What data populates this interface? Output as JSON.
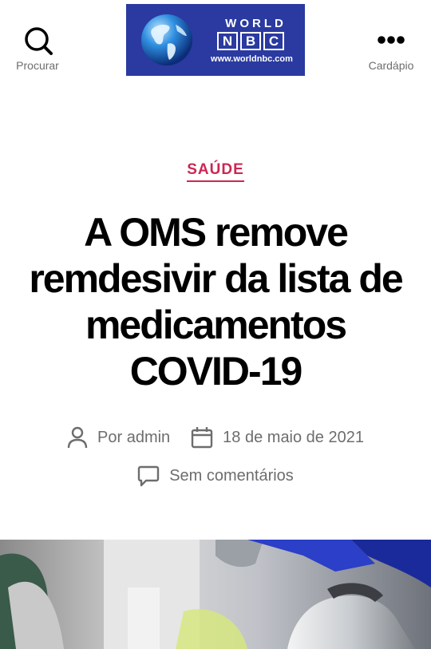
{
  "header": {
    "search_label": "Procurar",
    "search_icon": "search-icon",
    "menu_label": "Cardápio",
    "menu_icon": "more-dots-icon",
    "logo": {
      "world": "WORLD",
      "nbc_letters": [
        "N",
        "B",
        "C"
      ],
      "url": "www.worldnbc.com"
    }
  },
  "article": {
    "category": "SAÚDE",
    "title": "A OMS remove remdesivir da lista de medicamentos COVID-19",
    "author": "Por admin",
    "date": "18 de maio de 2021",
    "comments": "Sem comentários"
  },
  "colors": {
    "accent": "#cd2653",
    "logo_blue": "#2a3aa0",
    "meta_gray": "#6d6d6d"
  }
}
